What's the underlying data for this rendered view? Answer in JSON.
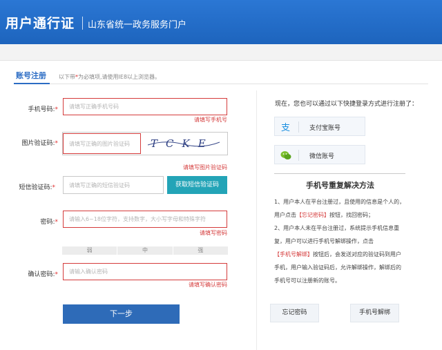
{
  "header": {
    "title": "用户通行证",
    "subtitle": "山东省统一政务服务门户"
  },
  "tab": {
    "label": "账号注册",
    "note_prefix": "以下带",
    "note_star": "*",
    "note_suffix": "为必填项,请使用IE8以上浏览器。"
  },
  "form": {
    "required_mark": "*",
    "phone": {
      "label": "手机号码:",
      "placeholder": "请填写正确手机号码",
      "error": "请填写手机号"
    },
    "captcha": {
      "label": "图片验证码:",
      "placeholder": "请填写正确的图片验证码",
      "image_text": "TCKE",
      "error": "请填写图片验证码"
    },
    "sms": {
      "label": "短信验证码:",
      "placeholder": "请填写正确的短信验证码",
      "button": "获取短信验证码"
    },
    "password": {
      "label": "密码:",
      "placeholder": "请输入6~18位字符，支持数字，大小写字母和特殊字符",
      "error": "请填写密码",
      "strength": [
        "弱",
        "中",
        "强"
      ]
    },
    "confirm": {
      "label": "确认密码:",
      "placeholder": "请输入确认密码",
      "error": "请填写确认密码"
    },
    "next_button": "下一步"
  },
  "alt_login": {
    "title": "现在，您也可以通过以下快捷登录方式进行注册了：",
    "alipay": {
      "label": "支付宝账号",
      "icon": "alipay-icon",
      "color": "#1a8fe0"
    },
    "wechat": {
      "label": "微信账号",
      "icon": "wechat-icon",
      "color": "#7bbf2e"
    }
  },
  "solution": {
    "title": "手机号重复解决方法",
    "p1_a": "1、用户本人在平台注册过，且使用的信息是个人的，用户点击",
    "p1_link": "【忘记密码】",
    "p1_b": "按钮，找回密码；",
    "p2_a": "2、用户本人未在平台注册过，系统提示手机信息重复，用户可以进行手机号解绑操作，点击",
    "p2_link": "【手机号解绑】",
    "p2_b": "按钮后，会发送对应的验证码到用户手机，用户输入验证码后，允许解绑操作，解绑后的手机号可以注册新的账号。",
    "forgot_button": "忘记密码",
    "unbind_button": "手机号解绑"
  }
}
